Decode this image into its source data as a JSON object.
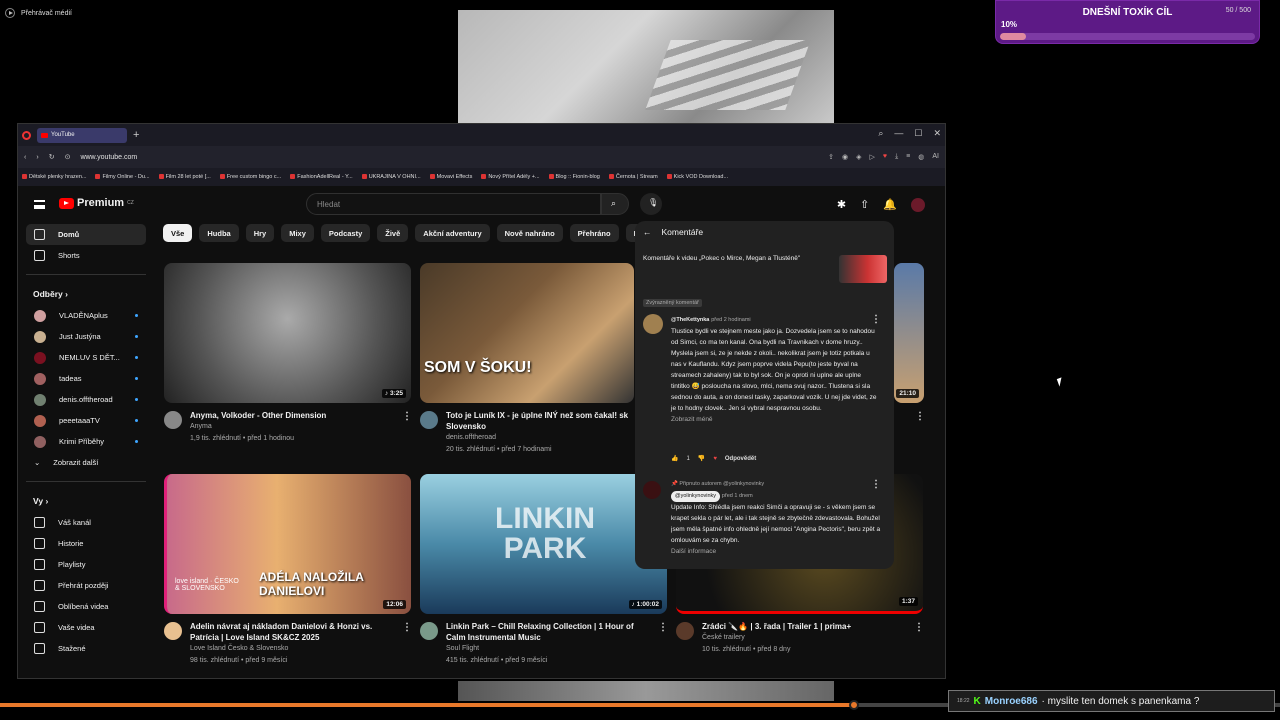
{
  "media_bar": {
    "title": "Přehrávač médií"
  },
  "overlay": {
    "goal_title": "DNEŠNÍ TOXÍK CÍL",
    "goal_count": "50 / 500",
    "goal_percent_label": "10%",
    "goal_progress": 0.1
  },
  "stream_progress": 0.667,
  "chat": {
    "time": "18:22",
    "badge": "K",
    "user": "Monroe686",
    "message": "· myslite ten domek s panenkama ?"
  },
  "browser": {
    "tab_title": "YouTube",
    "url": "www.youtube.com",
    "ai_label": "AI",
    "bookmarks": [
      "Dětské plenky hrazen...",
      "Filmy Online - Du...",
      "Film 28 let poté [...",
      "Free custom bingo c...",
      "FashionAdellReal - Y...",
      "UKRAJINA V OHNI...",
      "Movavi Effects",
      "Nový Přítel Adély +...",
      "Blog :: Fionin-blog",
      "Černota | Stream",
      "Kick VOD Download..."
    ]
  },
  "youtube": {
    "logo_text": "Premium",
    "logo_sup": "CZ",
    "search_placeholder": "Hledat",
    "sidebar": {
      "main": [
        {
          "label": "Domů",
          "icon": "home-icon",
          "active": true
        },
        {
          "label": "Shorts",
          "icon": "shorts-icon",
          "active": false
        }
      ],
      "subs_header": "Odběry",
      "subs": [
        {
          "label": "VLADĚNAplus",
          "color": "#d0a0a0",
          "dot": true
        },
        {
          "label": "Just Justýna",
          "color": "#c8b090",
          "dot": true
        },
        {
          "label": "NEMLUV S DĚT...",
          "color": "#7a1020",
          "dot": true
        },
        {
          "label": "tadeas",
          "color": "#a06060",
          "dot": true
        },
        {
          "label": "denis.offtheroad",
          "color": "#708070",
          "dot": true
        },
        {
          "label": "peeetaaaTV",
          "color": "#b06050",
          "dot": true
        },
        {
          "label": "Krimi Příběhy",
          "color": "#906060",
          "dot": true
        }
      ],
      "show_more": "Zobrazit další",
      "you_header": "Vy",
      "you": [
        {
          "label": "Váš kanál",
          "icon": "channel-icon"
        },
        {
          "label": "Historie",
          "icon": "history-icon"
        },
        {
          "label": "Playlisty",
          "icon": "playlist-icon"
        },
        {
          "label": "Přehrát později",
          "icon": "watch-later-icon"
        },
        {
          "label": "Oblíbená videa",
          "icon": "like-icon"
        },
        {
          "label": "Vaše videa",
          "icon": "your-videos-icon"
        },
        {
          "label": "Stažené",
          "icon": "download-icon"
        }
      ]
    },
    "chips": [
      "Vše",
      "Hudba",
      "Hry",
      "Mixy",
      "Podcasty",
      "Živě",
      "Akční adventury",
      "Nově nahráno",
      "Přehráno",
      "Pro vás nové"
    ],
    "videos": [
      {
        "title": "Anyma, Volkoder - Other Dimension",
        "channel": "Anyma",
        "meta": "1,9 tis. zhlédnutí • před 1 hodinou",
        "duration": "♪ 3:25",
        "overlay": ""
      },
      {
        "title": "Toto je Luník IX - je úplne INÝ než som čakal! sk Slovensko",
        "channel": "denis.offtheroad",
        "meta": "20 tis. zhlédnutí • před 7 hodinami",
        "duration": "",
        "overlay": "SOM V ŠOKU!"
      },
      {
        "title": "",
        "channel": "",
        "meta": "",
        "duration": "21:10",
        "overlay": ""
      },
      {
        "title": "Adelin návrat aj nákladom Danielovi & Honzi vs. Patrícia | Love Island SK&CZ 2025",
        "channel": "Love Island Česko & Slovensko",
        "meta": "98 tis. zhlédnutí • před 9 měsíci",
        "duration": "12:06",
        "overlay": "ADÉLA NALOŽILA DANIELOVI",
        "overlay_small": "love island · ČESKO & SLOVENSKO"
      },
      {
        "title": "Linkin Park – Chill Relaxing Collection | 1 Hour of Calm Instrumental Music",
        "channel": "Soul Flight",
        "meta": "415 tis. zhlédnutí • před 9 měsíci",
        "duration": "♪ 1:00:02",
        "overlay": "LINKIN PARK"
      },
      {
        "title": "Zrádci 🔪🔥 | 3. řada | Trailer 1 | prima+",
        "channel": "České trailery",
        "meta": "10 tis. zhlédnutí • před 8 dny",
        "duration": "1:37",
        "overlay": ""
      }
    ],
    "comments": {
      "header": "Komentáře",
      "video_ref": "Komentáře k videu „Pokec o Mirce, Megan a Tlusténě\"",
      "highlight": "Zvýrazněný komentář",
      "c1_user": "@TheKettynka",
      "c1_ago": "před 2 hodinami",
      "c1_text": "Tlustice bydli ve stejnem meste jako ja. Dozvedela jsem se to nahodou od Simci, co ma ten kanal. Ona bydli na Travnikach v dome hruzy.. Myslela jsem si, ze je nekde z okoli.. nekolikrat jsem je totiz potkala u nas v Kauflandu. Kdyz jsem poprve videla Pepu(to jeste byval na streamech zahaleny) tak to byl sok. On je oproti ni uplne ale uplne tintitko 😅 posloucha na slovo, mlci, nema svuj nazor.. Tlustena si sla sednou do auta, a on donesl tasky, zaparkoval vozik. U nej jde videt, ze je to hodny clovek.. Jen si vybral nespravnou osobu.",
      "c1_less": "Zobrazit méně",
      "c1_likes": "1",
      "reply": "Odpovědět",
      "c2_pinned": "Připnuto autorem @yolinkynovinky",
      "c2_user": "@yolinkynovinky",
      "c2_ago": "před 1 dnem",
      "c2_text": "Update Info: Shlédla jsem reakci Simči a opravuji se - s věkem jsem se krapet sekla o pár let, ale i tak stejně se zbytečně zdevastovala. Bohužel jsem měla špatné info ohledně její nemoci \"Angina Pectoris\", beru zpět a omlouvám se za chybn.",
      "c2_more": "Další informace"
    }
  }
}
